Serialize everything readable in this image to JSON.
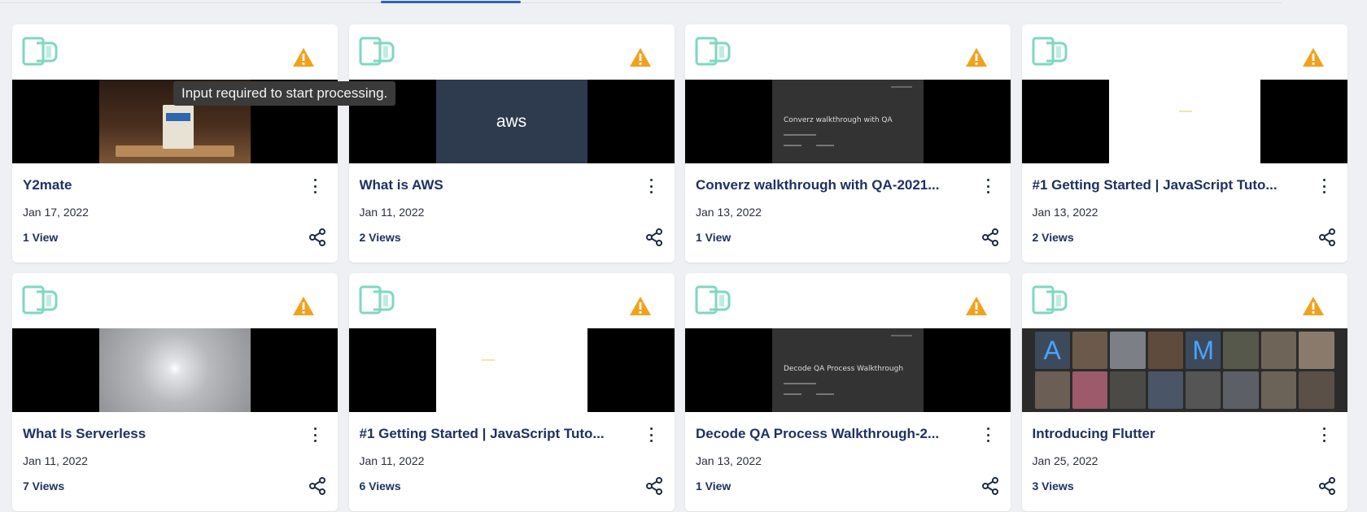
{
  "tooltip": "Input required to start processing.",
  "colors": {
    "accent": "#2f5fc0",
    "brand_icon": "#7fd7c0",
    "warning": "#f0a21e",
    "title": "#1e3163"
  },
  "icons": {
    "brand": "video-logo-icon",
    "warning": "warning-icon",
    "more": "kebab-menu-icon",
    "share": "share-icon"
  },
  "cards": [
    {
      "title": "Y2mate",
      "date": "Jan 17, 2022",
      "views": "1 View"
    },
    {
      "title": "What is AWS",
      "date": "Jan 11, 2022",
      "views": "2 Views",
      "thumb_text": "aws"
    },
    {
      "title": "Converz walkthrough with QA-2021...",
      "date": "Jan 13, 2022",
      "views": "1 View",
      "thumb_text": "Converz walkthrough with QA"
    },
    {
      "title": "#1 Getting Started | JavaScript Tuto...",
      "date": "Jan 13, 2022",
      "views": "2 Views"
    },
    {
      "title": "What Is Serverless",
      "date": "Jan 11, 2022",
      "views": "7 Views"
    },
    {
      "title": "#1 Getting Started | JavaScript Tuto...",
      "date": "Jan 11, 2022",
      "views": "6 Views"
    },
    {
      "title": "Decode QA Process Walkthrough-2...",
      "date": "Jan 13, 2022",
      "views": "1 View",
      "thumb_text": "Decode QA Process Walkthrough"
    },
    {
      "title": "Introducing Flutter",
      "date": "Jan 25, 2022",
      "views": "3 Views",
      "thumb_tiles": [
        "A",
        "M"
      ]
    }
  ]
}
